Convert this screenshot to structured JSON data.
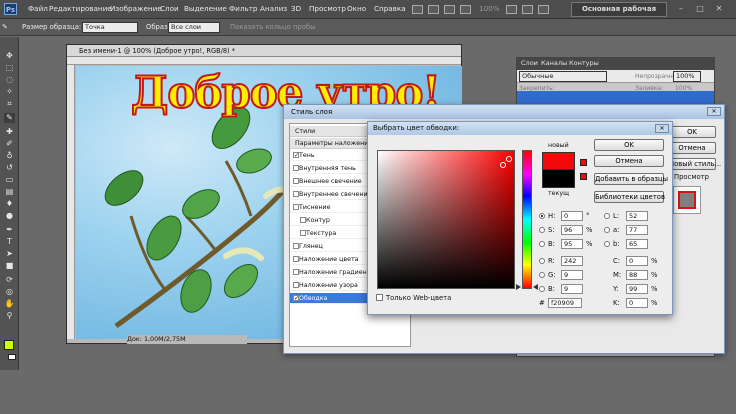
{
  "app": {
    "logo": "Ps"
  },
  "menu": [
    "Файл",
    "Редактирование",
    "Изображение",
    "Слои",
    "Выделение",
    "Фильтр",
    "Анализ",
    "3D",
    "Просмотр",
    "Окно",
    "Справка"
  ],
  "zoom": "100%",
  "workspace": "Основная рабочая среда",
  "options": {
    "sample_size_label": "Размер образца:",
    "sample_size_value": "Точка",
    "sample_label": "Образец:",
    "sample_value": "Все слои",
    "show_ring": "Показать кольцо пробы"
  },
  "document": {
    "title": "Без имени-1 @ 100% (Доброе утро!, RGB/8) *",
    "canvas_text": "Доброе утро!",
    "status": "Док: 1,00M/2,75M"
  },
  "layers_panel": {
    "tabs": [
      "Слои",
      "Каналы",
      "Контуры"
    ],
    "blend_mode": "Обычные",
    "opacity_label": "Непрозрачность:",
    "opacity_value": "100%",
    "fill_label": "Заливка:",
    "fill_value": "100%",
    "lock_label": "Закрепить:"
  },
  "layer_style": {
    "title": "Стиль слоя",
    "list": [
      {
        "label": "Стили",
        "type": "head"
      },
      {
        "label": "Параметры наложения: по умолч.",
        "type": "head"
      },
      {
        "label": "Тень",
        "checked": true
      },
      {
        "label": "Внутренняя тень",
        "checked": false
      },
      {
        "label": "Внешнее свечение",
        "checked": false
      },
      {
        "label": "Внутреннее свечение",
        "checked": false
      },
      {
        "label": "Тиснение",
        "checked": false
      },
      {
        "label": "Контур",
        "checked": false,
        "sub": true
      },
      {
        "label": "Текстура",
        "checked": false,
        "sub": true
      },
      {
        "label": "Глянец",
        "checked": false
      },
      {
        "label": "Наложение цвета",
        "checked": false
      },
      {
        "label": "Наложение градиента",
        "checked": false
      },
      {
        "label": "Наложение узора",
        "checked": false
      },
      {
        "label": "Обводка",
        "checked": true,
        "active": true
      }
    ],
    "ok": "OK",
    "cancel": "Отмена",
    "new_style": "Новый стиль...",
    "preview_label": "Просмотр"
  },
  "color_picker": {
    "title": "Выбрать цвет обводки:",
    "new_label": "новый",
    "current_label": "текущ",
    "ok": "OK",
    "cancel": "Отмена",
    "add_swatch": "Добавить в образцы",
    "libraries": "Библиотеки цветов",
    "web_only": "Только Web-цвета",
    "new_color": "#f20909",
    "current_color": "#000000",
    "values": {
      "H": {
        "label": "H:",
        "value": "0",
        "unit": "°"
      },
      "S": {
        "label": "S:",
        "value": "96",
        "unit": "%"
      },
      "B": {
        "label": "B:",
        "value": "95",
        "unit": "%"
      },
      "R": {
        "label": "R:",
        "value": "242",
        "unit": ""
      },
      "G": {
        "label": "G:",
        "value": "9",
        "unit": ""
      },
      "Bl": {
        "label": "B:",
        "value": "9",
        "unit": ""
      },
      "L": {
        "label": "L:",
        "value": "52",
        "unit": ""
      },
      "a": {
        "label": "a:",
        "value": "77",
        "unit": ""
      },
      "b": {
        "label": "b:",
        "value": "65",
        "unit": ""
      },
      "C": {
        "label": "C:",
        "value": "0",
        "unit": "%"
      },
      "M": {
        "label": "M:",
        "value": "88",
        "unit": "%"
      },
      "Y": {
        "label": "Y:",
        "value": "99",
        "unit": "%"
      },
      "K": {
        "label": "K:",
        "value": "0",
        "unit": "%"
      }
    },
    "hex_label": "#",
    "hex": "f20909"
  }
}
